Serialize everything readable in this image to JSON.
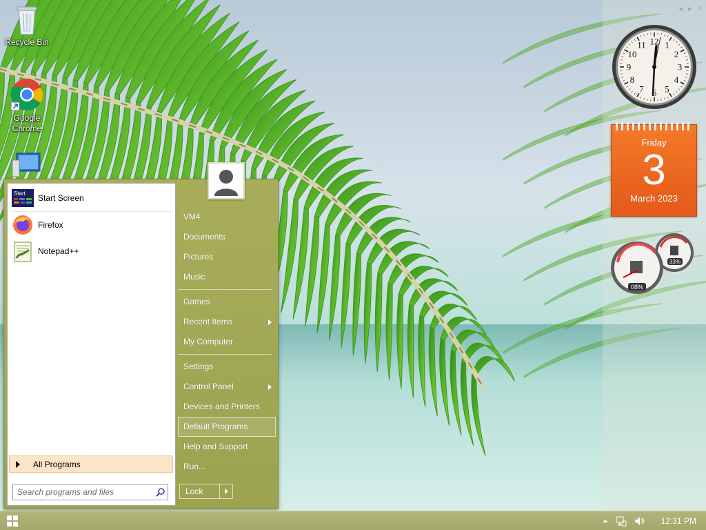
{
  "desktop": {
    "icons": [
      {
        "label": "Recycle Bin",
        "icon": "recycle-bin-icon"
      },
      {
        "label": "Google\nChrome",
        "label_line1": "Google",
        "label_line2": "Chrome",
        "icon": "chrome-icon"
      },
      {
        "label": "",
        "icon": "computer-icon"
      }
    ]
  },
  "sidebar": {
    "nav_prev": "◂",
    "nav_next": "▸",
    "nav_add": "+"
  },
  "calendar": {
    "day": "Friday",
    "date": "3",
    "month_year": "March 2023"
  },
  "meter": {
    "cpu": "08%",
    "memory": "33%"
  },
  "start_menu": {
    "pinned": [
      {
        "label": "Start Screen",
        "icon": "start-screen-icon"
      },
      {
        "label": "Firefox",
        "icon": "firefox-icon"
      },
      {
        "label": "Notepad++",
        "icon": "notepad-plus-plus-icon"
      }
    ],
    "all_programs": "All Programs",
    "search_placeholder": "Search programs and files",
    "right_items": {
      "vm4": "VM4",
      "documents": "Documents",
      "pictures": "Pictures",
      "music": "Music",
      "games": "Games",
      "recent_items": "Recent Items",
      "my_computer": "My Computer",
      "settings": "Settings",
      "control_panel": "Control Panel",
      "devices_printers": "Devices and Printers",
      "default_programs": "Default Programs",
      "help_support": "Help and Support",
      "run": "Run..."
    },
    "lock_label": "Lock"
  },
  "taskbar": {
    "time": "12:31 PM"
  },
  "colors": {
    "start_menu_bg": "#a8ad5a",
    "calendar_bg": "#f57a2a",
    "all_programs_highlight": "#fbe5c8",
    "taskbar_bg": "#a3a86b"
  }
}
